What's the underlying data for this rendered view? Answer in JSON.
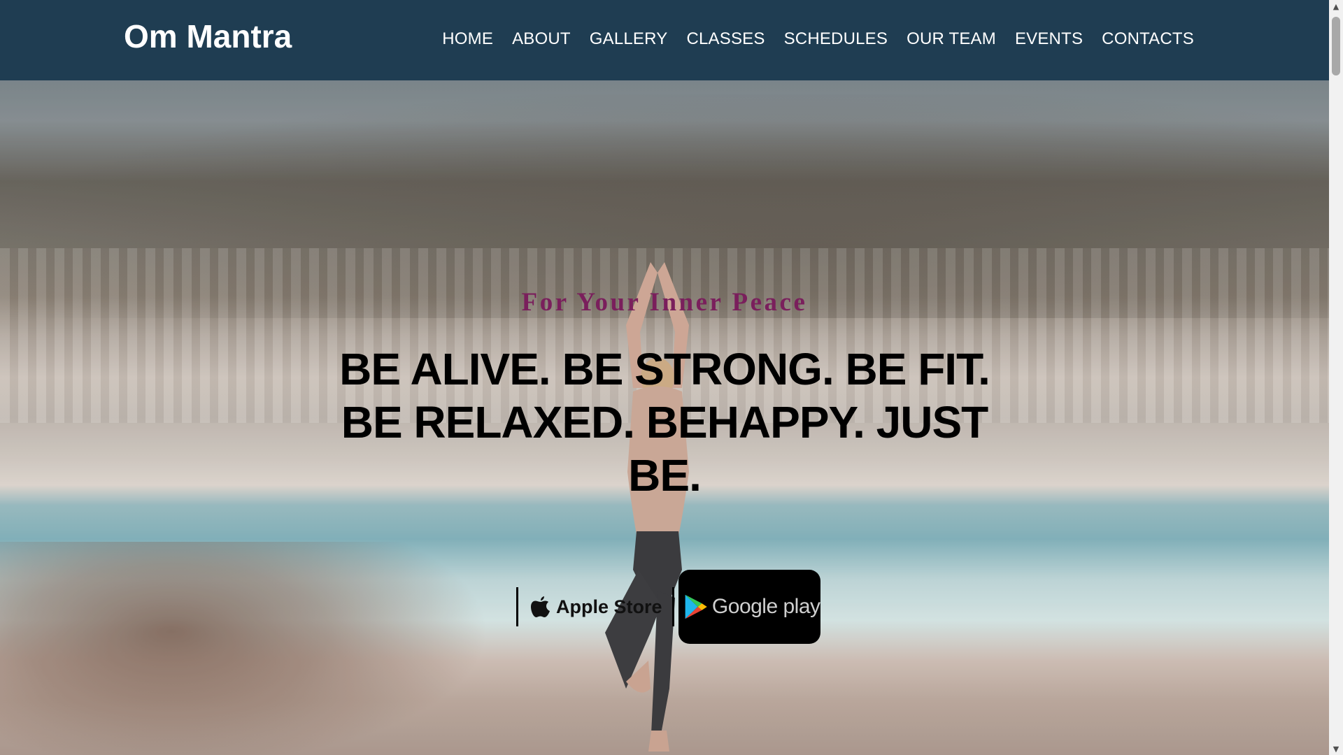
{
  "brand": {
    "name": "Om Mantra"
  },
  "nav": {
    "items": [
      {
        "label": "HOME"
      },
      {
        "label": "ABOUT"
      },
      {
        "label": "GALLERY"
      },
      {
        "label": "CLASSES"
      },
      {
        "label": "SCHEDULES"
      },
      {
        "label": "OUR TEAM"
      },
      {
        "label": "EVENTS"
      },
      {
        "label": "CONTACTS"
      }
    ]
  },
  "hero": {
    "tagline": "For Your Inner Peace",
    "headline": "BE ALIVE. BE STRONG. BE FIT. BE RELAXED. BEHAPPY. JUST BE.",
    "background_image": "woman-yoga-tree-pose-on-beach",
    "apple_store": {
      "label": "Apple Store",
      "icon": "apple-icon"
    },
    "google_play": {
      "label": "Google play",
      "icon": "google-play-icon"
    }
  },
  "colors": {
    "navbar_bg": "#1f3d52",
    "tagline": "#7a1f5c",
    "headline": "#000000",
    "nav_text": "#ffffff"
  },
  "scrollbar": {
    "up_icon": "scroll-up-arrow-icon",
    "down_icon": "scroll-down-arrow-icon"
  }
}
